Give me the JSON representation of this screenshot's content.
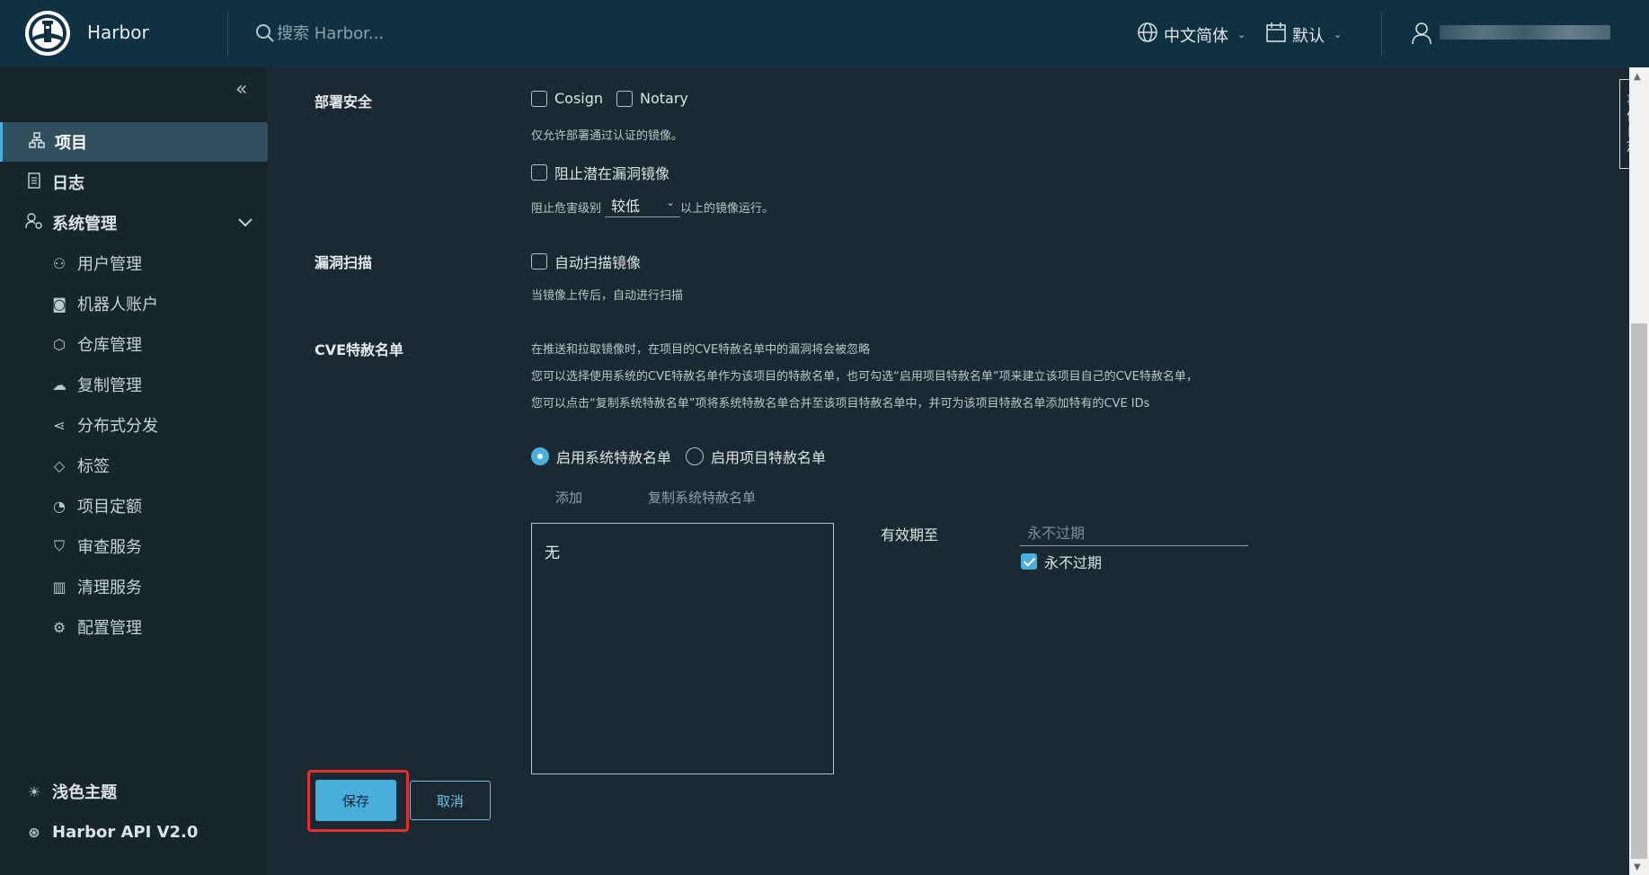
{
  "header": {
    "brand": "Harbor",
    "search_placeholder": "搜索 Harbor...",
    "language": "中文简体",
    "datetime": "默认"
  },
  "sidebar": {
    "items": [
      {
        "label": "项目",
        "icon": "project-icon"
      },
      {
        "label": "日志",
        "icon": "log-icon"
      },
      {
        "label": "系统管理",
        "icon": "admin-icon"
      }
    ],
    "sub_items": [
      {
        "label": "用户管理",
        "icon": "users-icon"
      },
      {
        "label": "机器人账户",
        "icon": "robot-icon"
      },
      {
        "label": "仓库管理",
        "icon": "registry-icon"
      },
      {
        "label": "复制管理",
        "icon": "replication-icon"
      },
      {
        "label": "分布式分发",
        "icon": "share-icon"
      },
      {
        "label": "标签",
        "icon": "tag-icon"
      },
      {
        "label": "项目定额",
        "icon": "quota-icon"
      },
      {
        "label": "审查服务",
        "icon": "shield-icon"
      },
      {
        "label": "清理服务",
        "icon": "trash-icon"
      },
      {
        "label": "配置管理",
        "icon": "gear-icon"
      }
    ],
    "theme": "浅色主题",
    "api": "Harbor API V2.0"
  },
  "side_tab": "事件日志",
  "deploy_security": {
    "label": "部署安全",
    "cosign": "Cosign",
    "notary": "Notary",
    "help": "仅允许部署通过认证的镜像。",
    "prevent_vul": "阻止潜在漏洞镜像",
    "severity_prefix": "阻止危害级别",
    "severity_value": "较低",
    "severity_suffix": "以上的镜像运行。"
  },
  "vul_scan": {
    "label": "漏洞扫描",
    "auto_scan": "自动扫描镜像",
    "help": "当镜像上传后，自动进行扫描"
  },
  "cve": {
    "label": "CVE特赦名单",
    "desc1": "在推送和拉取镜像时，在项目的CVE特赦名单中的漏洞将会被忽略",
    "desc2": "您可以选择使用系统的CVE特赦名单作为该项目的特赦名单，也可勾选“启用项目特赦名单”项来建立该项目自己的CVE特赦名单，",
    "desc3": "您可以点击“复制系统特赦名单”项将系统特赦名单合并至该项目特赦名单中，并可为该项目特赦名单添加特有的CVE IDs",
    "radio_system": "启用系统特赦名单",
    "radio_project": "启用项目特赦名单",
    "add": "添加",
    "copy_system": "复制系统特赦名单",
    "list_empty": "无",
    "expire_label": "有效期至",
    "expire_placeholder": "永不过期",
    "never_expire": "永不过期"
  },
  "actions": {
    "save": "保存",
    "cancel": "取消"
  },
  "colors": {
    "header": "#0f3142",
    "sidebar": "#17252c",
    "main": "#1b2a32",
    "accent": "#49aedb",
    "highlight": "#e52f2f"
  }
}
